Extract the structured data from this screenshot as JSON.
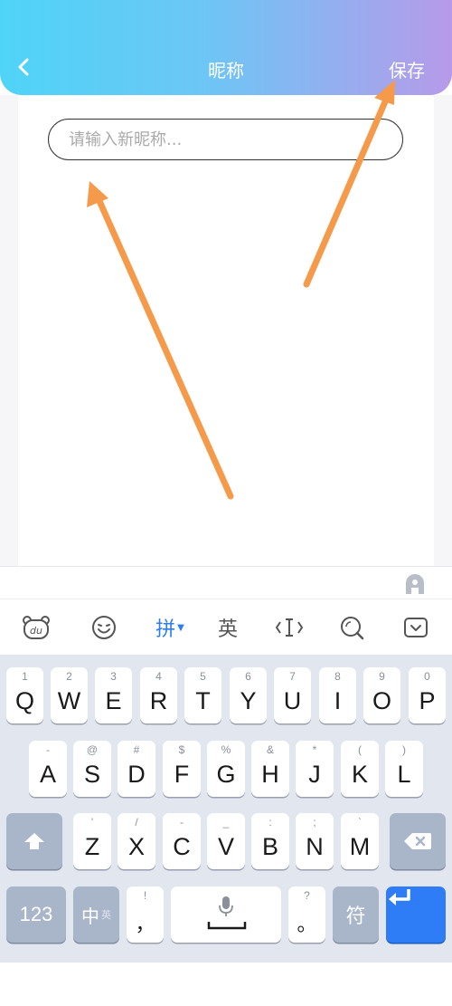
{
  "header": {
    "title": "昵称",
    "save_label": "保存"
  },
  "nickname_input": {
    "placeholder": "请输入新昵称...",
    "value": ""
  },
  "toolbar": {
    "pinyin_label": "拼",
    "english_label": "英"
  },
  "keyboard": {
    "row1": [
      {
        "letter": "Q",
        "sub": "1"
      },
      {
        "letter": "W",
        "sub": "2"
      },
      {
        "letter": "E",
        "sub": "3"
      },
      {
        "letter": "R",
        "sub": "4"
      },
      {
        "letter": "T",
        "sub": "5"
      },
      {
        "letter": "Y",
        "sub": "6"
      },
      {
        "letter": "U",
        "sub": "7"
      },
      {
        "letter": "I",
        "sub": "8"
      },
      {
        "letter": "O",
        "sub": "9"
      },
      {
        "letter": "P",
        "sub": "0"
      }
    ],
    "row2": [
      {
        "letter": "A",
        "sub": "-"
      },
      {
        "letter": "S",
        "sub": "@"
      },
      {
        "letter": "D",
        "sub": "#"
      },
      {
        "letter": "F",
        "sub": "$"
      },
      {
        "letter": "G",
        "sub": "%"
      },
      {
        "letter": "H",
        "sub": "&"
      },
      {
        "letter": "J",
        "sub": "*"
      },
      {
        "letter": "K",
        "sub": "("
      },
      {
        "letter": "L",
        "sub": ")"
      }
    ],
    "row3": [
      {
        "letter": "Z",
        "sub": "'"
      },
      {
        "letter": "X",
        "sub": "/"
      },
      {
        "letter": "C",
        "sub": "-"
      },
      {
        "letter": "V",
        "sub": "_"
      },
      {
        "letter": "B",
        "sub": ":"
      },
      {
        "letter": "N",
        "sub": ";"
      },
      {
        "letter": "M",
        "sub": "`"
      }
    ],
    "num_label": "123",
    "lang_main": "中",
    "lang_sub": "英",
    "comma_sub": "!",
    "comma_main": "，",
    "period_sub": "?",
    "period_main": "。",
    "symbol_label": "符"
  },
  "colors": {
    "header_gradient_start": "#4fd4f7",
    "header_gradient_end": "#b79ae9",
    "annotation_arrow": "#f59a4a",
    "keyboard_bg": "#e2e6ef",
    "enter_key": "#2f7df6"
  }
}
